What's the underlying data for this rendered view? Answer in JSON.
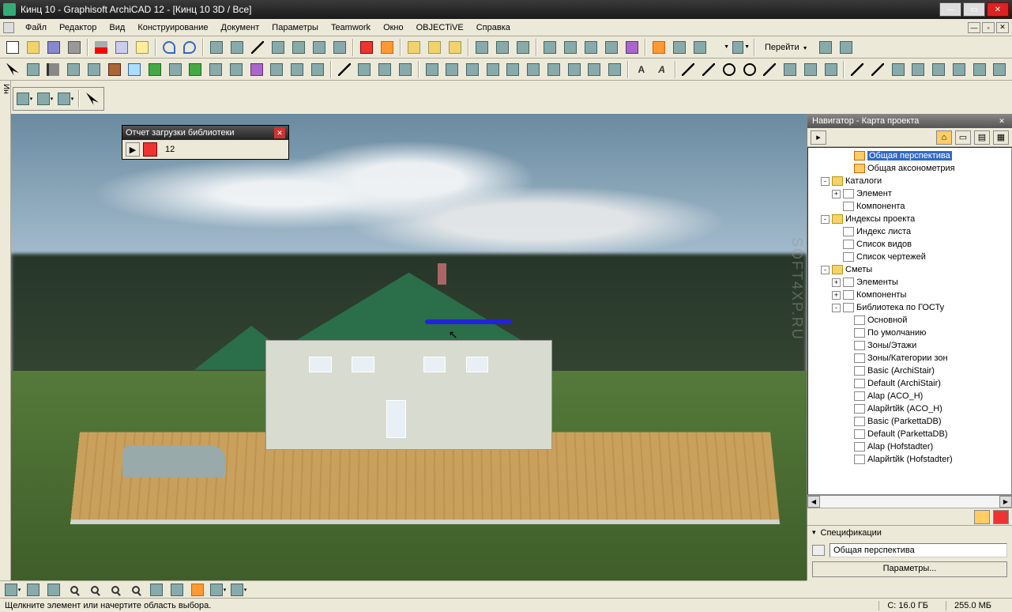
{
  "window": {
    "title": "Кинц 10 - Graphisoft ArchiCAD 12 - [Кинц 10 3D / Все]"
  },
  "menu": [
    "Файл",
    "Редактор",
    "Вид",
    "Конструирование",
    "Документ",
    "Параметры",
    "Teamwork",
    "Окно",
    "OBJECTiVE",
    "Справка"
  ],
  "goto": "Перейти",
  "sidebar_label": "Ин",
  "report": {
    "title": "Отчет загрузки библиотеки",
    "count": "12"
  },
  "navigator": {
    "title": "Навигатор - Карта проекта",
    "tree": [
      {
        "ind": 3,
        "exp": "",
        "icon": "ti-cam",
        "label": "Общая перспектива",
        "sel": true
      },
      {
        "ind": 3,
        "exp": "",
        "icon": "ti-cam",
        "label": "Общая аксонометрия"
      },
      {
        "ind": 1,
        "exp": "-",
        "icon": "ti-folder",
        "label": "Каталоги"
      },
      {
        "ind": 2,
        "exp": "+",
        "icon": "ti-doc",
        "label": "Элемент"
      },
      {
        "ind": 2,
        "exp": "",
        "icon": "ti-doc",
        "label": "Компонента"
      },
      {
        "ind": 1,
        "exp": "-",
        "icon": "ti-folder",
        "label": "Индексы проекта"
      },
      {
        "ind": 2,
        "exp": "",
        "icon": "ti-doc",
        "label": "Индекс листа"
      },
      {
        "ind": 2,
        "exp": "",
        "icon": "ti-doc",
        "label": "Список видов"
      },
      {
        "ind": 2,
        "exp": "",
        "icon": "ti-doc",
        "label": "Список чертежей"
      },
      {
        "ind": 1,
        "exp": "-",
        "icon": "ti-folder",
        "label": "Сметы"
      },
      {
        "ind": 2,
        "exp": "+",
        "icon": "ti-doc",
        "label": "Элементы"
      },
      {
        "ind": 2,
        "exp": "+",
        "icon": "ti-doc",
        "label": "Компоненты"
      },
      {
        "ind": 2,
        "exp": "-",
        "icon": "ti-doc",
        "label": "Библиотека по ГОСТу"
      },
      {
        "ind": 3,
        "exp": "",
        "icon": "ti-doc",
        "label": "Основной"
      },
      {
        "ind": 3,
        "exp": "",
        "icon": "ti-doc",
        "label": "По умолчанию"
      },
      {
        "ind": 3,
        "exp": "",
        "icon": "ti-doc",
        "label": "Зоны/Этажи"
      },
      {
        "ind": 3,
        "exp": "",
        "icon": "ti-doc",
        "label": "Зоны/Категории зон"
      },
      {
        "ind": 3,
        "exp": "",
        "icon": "ti-doc",
        "label": "Basic (ArchiStair)"
      },
      {
        "ind": 3,
        "exp": "",
        "icon": "ti-doc",
        "label": "Default (ArchiStair)"
      },
      {
        "ind": 3,
        "exp": "",
        "icon": "ti-doc",
        "label": "Alap (ACO_H)"
      },
      {
        "ind": 3,
        "exp": "",
        "icon": "ti-doc",
        "label": "Alapйrtйk (ACO_H)"
      },
      {
        "ind": 3,
        "exp": "",
        "icon": "ti-doc",
        "label": "Basic (ParkettaDB)"
      },
      {
        "ind": 3,
        "exp": "",
        "icon": "ti-doc",
        "label": "Default (ParkettaDB)"
      },
      {
        "ind": 3,
        "exp": "",
        "icon": "ti-doc",
        "label": "Alap (Hofstadter)"
      },
      {
        "ind": 3,
        "exp": "",
        "icon": "ti-doc",
        "label": "Alapйrtйk (Hofstadter)"
      }
    ],
    "spec_title": "Спецификации",
    "spec_value": "Общая перспектива",
    "params_btn": "Параметры..."
  },
  "status": {
    "hint": "Щелкните элемент или начертите область выбора.",
    "c": "С: 16.0 ГБ",
    "d": "255.0 МБ"
  },
  "watermark": "SOFT4XP.RU"
}
